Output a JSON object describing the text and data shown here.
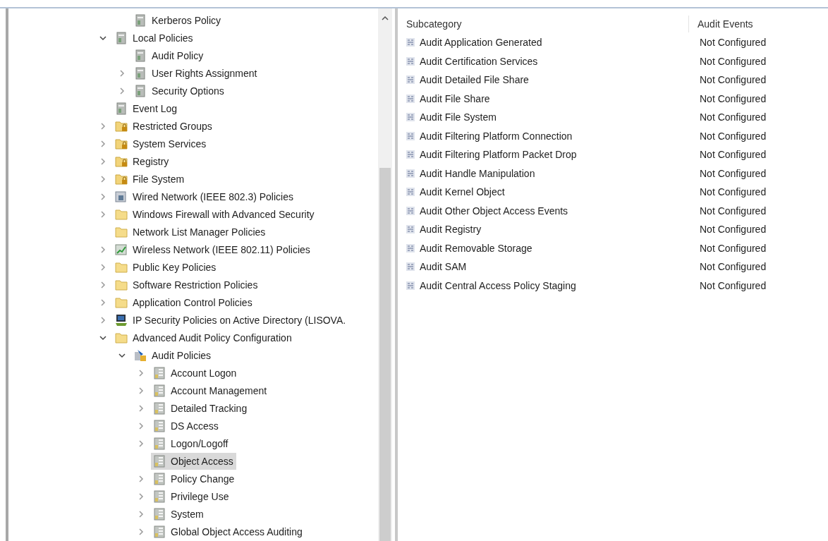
{
  "tree": {
    "items": [
      {
        "children": [
          {
            "label": "Kerberos Policy",
            "kind": "policy",
            "selected": false
          }
        ]
      },
      {
        "label": "Local Policies",
        "kind": "policy",
        "expanded": true,
        "selected": false,
        "children": [
          {
            "label": "Audit Policy",
            "kind": "policy",
            "selected": false
          },
          {
            "label": "User Rights Assignment",
            "kind": "policy",
            "expanded": false,
            "selected": false
          },
          {
            "label": "Security Options",
            "kind": "policy",
            "expanded": false,
            "selected": false
          }
        ]
      },
      {
        "label": "Event Log",
        "kind": "policy",
        "selected": false
      },
      {
        "label": "Restricted Groups",
        "kind": "locked-folder",
        "expanded": false,
        "selected": false
      },
      {
        "label": "System Services",
        "kind": "locked-folder",
        "expanded": false,
        "selected": false
      },
      {
        "label": "Registry",
        "kind": "locked-folder",
        "expanded": false,
        "selected": false
      },
      {
        "label": "File System",
        "kind": "locked-folder",
        "expanded": false,
        "selected": false
      },
      {
        "label": "Wired Network (IEEE 802.3) Policies",
        "kind": "network",
        "expanded": false,
        "selected": false
      },
      {
        "label": "Windows Firewall with Advanced Security",
        "kind": "folder",
        "expanded": false,
        "selected": false
      },
      {
        "label": "Network List Manager Policies",
        "kind": "folder",
        "selected": false
      },
      {
        "label": "Wireless Network (IEEE 802.11) Policies",
        "kind": "wireless",
        "expanded": false,
        "selected": false
      },
      {
        "label": "Public Key Policies",
        "kind": "folder",
        "expanded": false,
        "selected": false
      },
      {
        "label": "Software Restriction Policies",
        "kind": "folder",
        "expanded": false,
        "selected": false
      },
      {
        "label": "Application Control Policies",
        "kind": "folder",
        "expanded": false,
        "selected": false
      },
      {
        "label": "IP Security Policies on Active Directory (LISOVA.",
        "kind": "computer",
        "expanded": false,
        "selected": false
      },
      {
        "label": "Advanced Audit Policy Configuration",
        "kind": "folder",
        "expanded": true,
        "selected": false,
        "children": [
          {
            "label": "Audit Policies",
            "kind": "audit",
            "expanded": true,
            "selected": false,
            "children": [
              {
                "label": "Account Logon",
                "kind": "category",
                "expanded": false,
                "selected": false
              },
              {
                "label": "Account Management",
                "kind": "category",
                "expanded": false,
                "selected": false
              },
              {
                "label": "Detailed Tracking",
                "kind": "category",
                "expanded": false,
                "selected": false
              },
              {
                "label": "DS Access",
                "kind": "category",
                "expanded": false,
                "selected": false
              },
              {
                "label": "Logon/Logoff",
                "kind": "category",
                "expanded": false,
                "selected": false
              },
              {
                "label": "Object Access",
                "kind": "category",
                "selected": true
              },
              {
                "label": "Policy Change",
                "kind": "category",
                "expanded": false,
                "selected": false
              },
              {
                "label": "Privilege Use",
                "kind": "category",
                "expanded": false,
                "selected": false
              },
              {
                "label": "System",
                "kind": "category",
                "expanded": false,
                "selected": false
              },
              {
                "label": "Global Object Access Auditing",
                "kind": "category",
                "expanded": false,
                "selected": false
              }
            ]
          }
        ]
      }
    ]
  },
  "table": {
    "columns": [
      "Subcategory",
      "Audit Events"
    ],
    "rows": [
      {
        "subcategory": "Audit Application Generated",
        "audit_events": "Not Configured"
      },
      {
        "subcategory": "Audit Certification Services",
        "audit_events": "Not Configured"
      },
      {
        "subcategory": "Audit Detailed File Share",
        "audit_events": "Not Configured"
      },
      {
        "subcategory": "Audit File Share",
        "audit_events": "Not Configured"
      },
      {
        "subcategory": "Audit File System",
        "audit_events": "Not Configured"
      },
      {
        "subcategory": "Audit Filtering Platform Connection",
        "audit_events": "Not Configured"
      },
      {
        "subcategory": "Audit Filtering Platform Packet Drop",
        "audit_events": "Not Configured"
      },
      {
        "subcategory": "Audit Handle Manipulation",
        "audit_events": "Not Configured"
      },
      {
        "subcategory": "Audit Kernel Object",
        "audit_events": "Not Configured"
      },
      {
        "subcategory": "Audit Other Object Access Events",
        "audit_events": "Not Configured"
      },
      {
        "subcategory": "Audit Registry",
        "audit_events": "Not Configured"
      },
      {
        "subcategory": "Audit Removable Storage",
        "audit_events": "Not Configured"
      },
      {
        "subcategory": "Audit SAM",
        "audit_events": "Not Configured"
      },
      {
        "subcategory": "Audit Central Access Policy Staging",
        "audit_events": "Not Configured"
      }
    ]
  }
}
